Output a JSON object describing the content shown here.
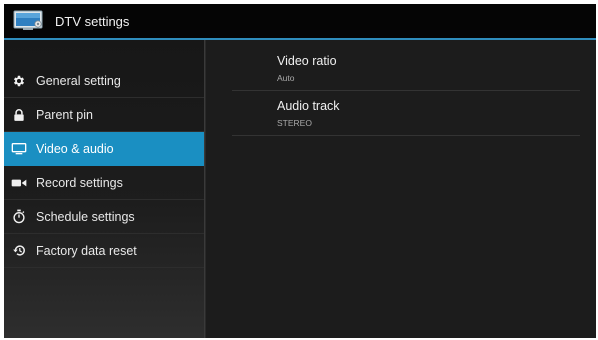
{
  "titlebar": {
    "title": "DTV settings",
    "icon": "tv-icon"
  },
  "colors": {
    "accent": "#1a8fc2",
    "titlebar_line": "#2f8dbd"
  },
  "sidebar": {
    "items": [
      {
        "label": "General setting",
        "icon": "gear-icon",
        "active": false
      },
      {
        "label": "Parent pin",
        "icon": "lock-icon",
        "active": false
      },
      {
        "label": "Video & audio",
        "icon": "monitor-icon",
        "active": true
      },
      {
        "label": "Record settings",
        "icon": "video-camera-icon",
        "active": false
      },
      {
        "label": "Schedule settings",
        "icon": "stopwatch-icon",
        "active": false
      },
      {
        "label": "Factory data reset",
        "icon": "restore-icon",
        "active": false
      }
    ]
  },
  "main": {
    "settings": [
      {
        "title": "Video ratio",
        "value": "Auto"
      },
      {
        "title": "Audio track",
        "value": "STEREO"
      }
    ]
  }
}
